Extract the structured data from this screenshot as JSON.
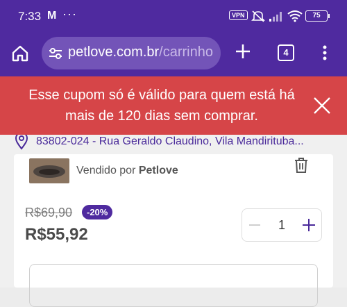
{
  "status_bar": {
    "time": "7:33",
    "mail_icon": "M",
    "more_dots": "···",
    "vpn": "VPN",
    "battery": "75"
  },
  "browser": {
    "url_domain": "petlove.com.br",
    "url_path": "/carrinho",
    "tab_count": "4"
  },
  "toast": {
    "message": "Esse cupom só é válido para quem está há mais de 120 dias sem comprar.",
    "color": "#d64548"
  },
  "delivery": {
    "address": "83802-024 - Rua Geraldo Claudino, Vila Mandirituba..."
  },
  "cart_item": {
    "sold_by_prefix": "Vendido por",
    "seller": "Petlove",
    "old_price": "R$69,90",
    "discount": "-20%",
    "price": "R$55,92",
    "quantity": "1"
  },
  "colors": {
    "brand_purple": "#4f2a9f",
    "alert_red": "#d64548"
  }
}
